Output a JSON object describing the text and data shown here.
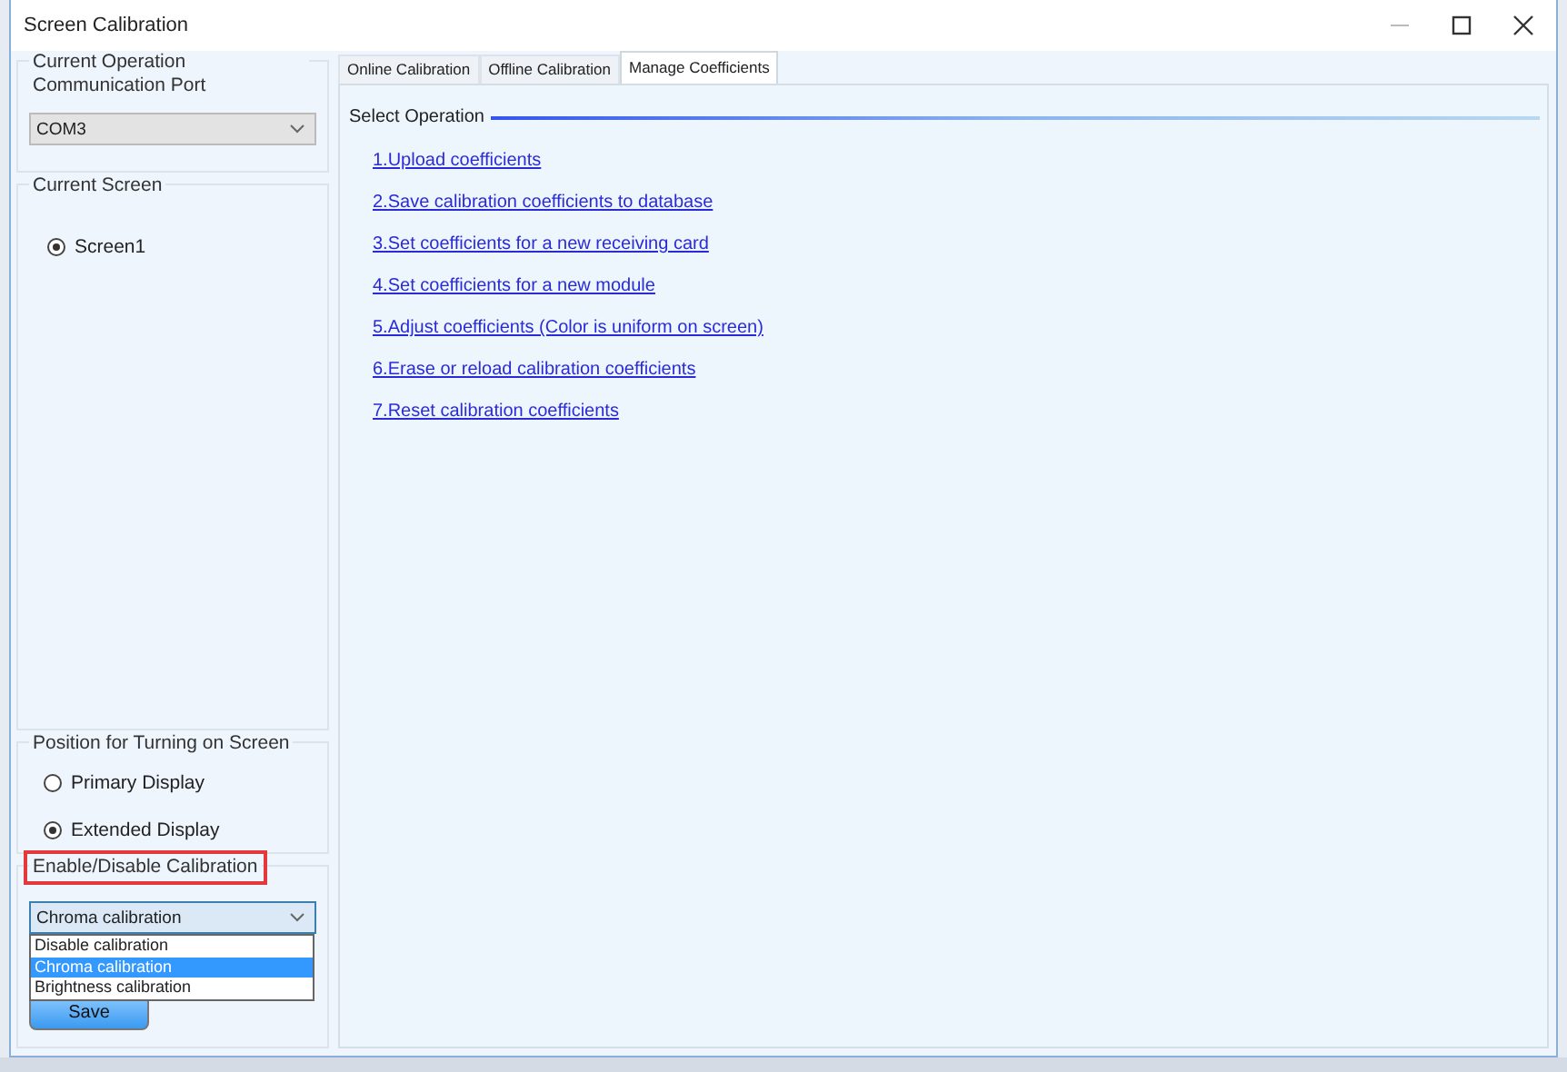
{
  "window": {
    "title": "Screen Calibration"
  },
  "port_group": {
    "label": "Current Operation Communication Port",
    "combo": {
      "value": "COM3",
      "disabled": true
    }
  },
  "screen_group": {
    "label": "Current Screen",
    "radios": [
      {
        "label": "Screen1",
        "selected": true
      }
    ]
  },
  "position_group": {
    "label": "Position for Turning on Screen",
    "radios": [
      {
        "label": "Primary Display",
        "selected": false
      },
      {
        "label": "Extended Display",
        "selected": true
      }
    ]
  },
  "calibration_group": {
    "label": "Enable/Disable Calibration",
    "highlighted": true,
    "combo": {
      "value": "Chroma calibration",
      "expanded": true,
      "options": [
        {
          "label": "Disable calibration",
          "selected": false
        },
        {
          "label": "Chroma calibration",
          "selected": true
        },
        {
          "label": "Brightness calibration",
          "selected": false
        }
      ]
    },
    "save_button": "Save"
  },
  "tabs": [
    {
      "label": "Online Calibration",
      "selected": false
    },
    {
      "label": "Offline Calibration",
      "selected": false
    },
    {
      "label": "Manage Coefficients",
      "selected": true
    }
  ],
  "operations": {
    "label": "Select Operation",
    "links": [
      "1.Upload coefficients",
      "2.Save calibration coefficients to database",
      "3.Set coefficients for a new receiving card",
      "4.Set coefficients for a new module",
      "5.Adjust coefficients (Color is uniform on screen)",
      "6.Erase or reload calibration coefficients",
      "7.Reset calibration coefficients"
    ]
  }
}
